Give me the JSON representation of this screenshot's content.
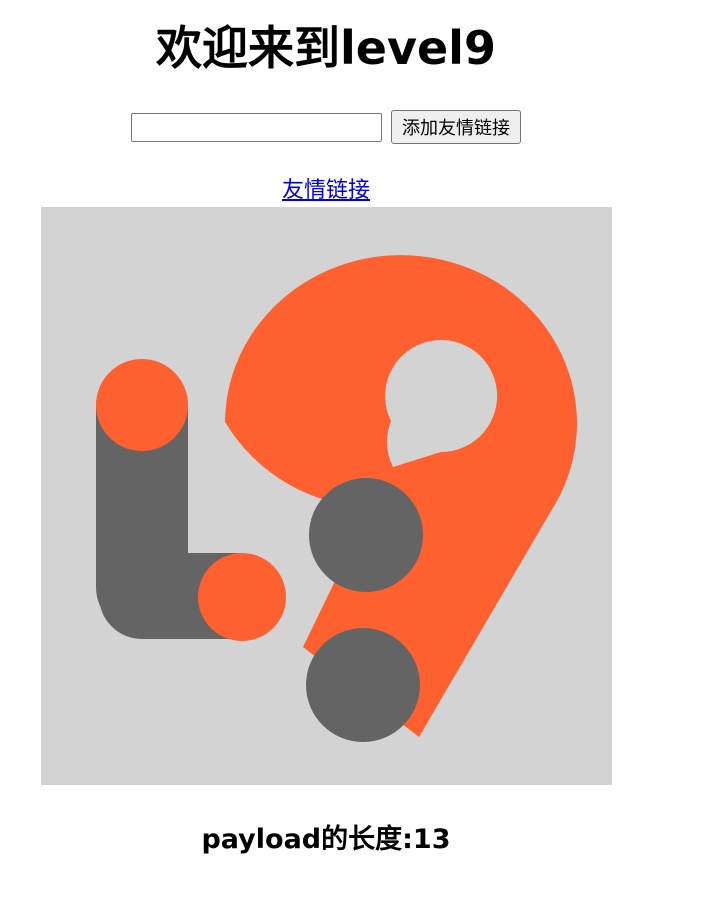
{
  "page": {
    "title": "欢迎来到level9"
  },
  "form": {
    "input_value": "",
    "input_placeholder": "",
    "submit_label": "添加友情链接"
  },
  "friend_link": {
    "label": "友情链接"
  },
  "logo": {
    "icon": "level9-logo-icon",
    "colors": {
      "background": "#d3d3d3",
      "orange": "#ff6030",
      "gray": "#646464"
    }
  },
  "payload": {
    "label": "payload的长度:13"
  }
}
